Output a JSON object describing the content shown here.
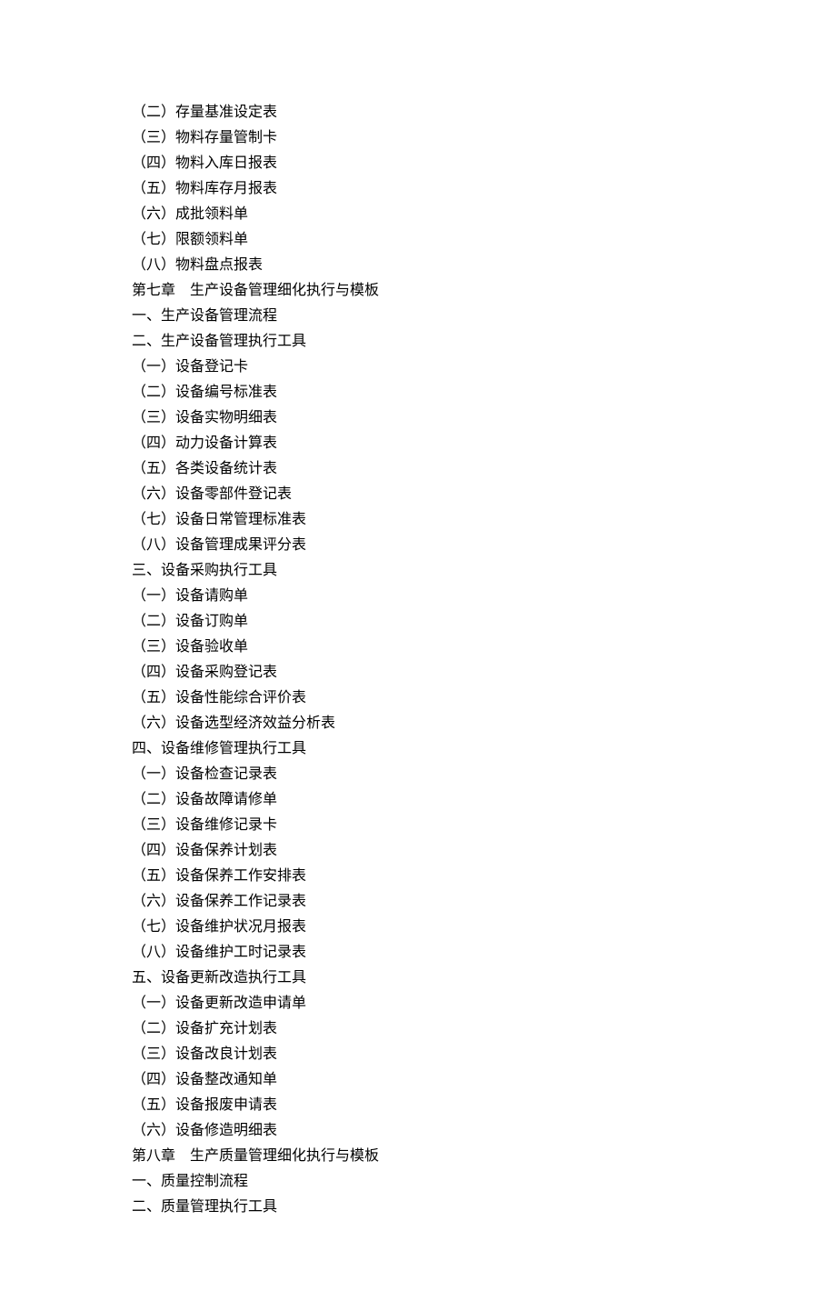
{
  "lines": [
    "（二）存量基准设定表",
    "（三）物料存量管制卡",
    "（四）物料入库日报表",
    "（五）物料库存月报表",
    "（六）成批领料单",
    "（七）限额领料单",
    "（八）物料盘点报表",
    "第七章　生产设备管理细化执行与模板",
    "一、生产设备管理流程",
    "二、生产设备管理执行工具",
    "（一）设备登记卡",
    "（二）设备编号标准表",
    "（三）设备实物明细表",
    "（四）动力设备计算表",
    "（五）各类设备统计表",
    "（六）设备零部件登记表",
    "（七）设备日常管理标准表",
    "（八）设备管理成果评分表",
    "三、设备采购执行工具",
    "（一）设备请购单",
    "（二）设备订购单",
    "（三）设备验收单",
    "（四）设备采购登记表",
    "（五）设备性能综合评价表",
    "（六）设备选型经济效益分析表",
    "四、设备维修管理执行工具",
    "（一）设备检查记录表",
    "（二）设备故障请修单",
    "（三）设备维修记录卡",
    "（四）设备保养计划表",
    "（五）设备保养工作安排表",
    "（六）设备保养工作记录表",
    "（七）设备维护状况月报表",
    "（八）设备维护工时记录表",
    "五、设备更新改造执行工具",
    "（一）设备更新改造申请单",
    "（二）设备扩充计划表",
    "（三）设备改良计划表",
    "（四）设备整改通知单",
    "（五）设备报废申请表",
    "（六）设备修造明细表",
    "第八章　生产质量管理细化执行与模板",
    "一、质量控制流程",
    "二、质量管理执行工具"
  ]
}
